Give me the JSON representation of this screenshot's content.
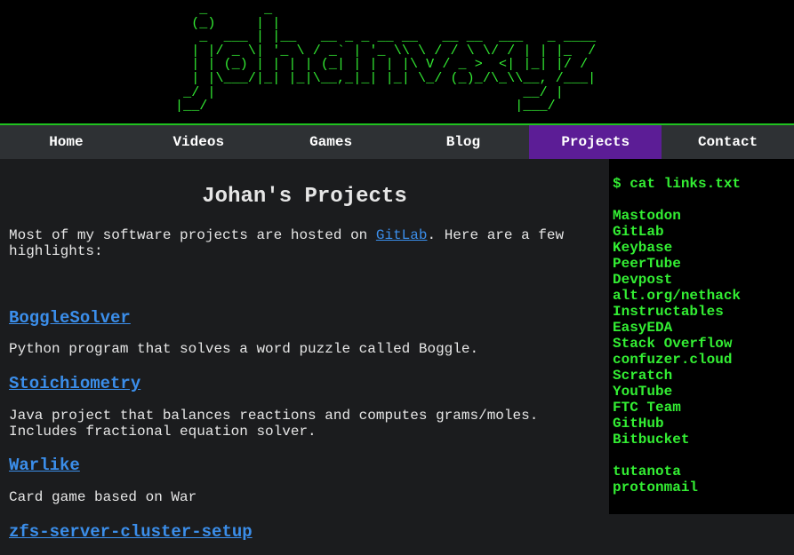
{
  "banner": {
    "ascii_logo": "   _       _                                        \n  (_)     | |                                       \n   _  ___ | |__   __ _ _ __ __   __ __  ___   _ ____\n  | |/ _ \\| '_ \\ / _` | '_ \\\\ \\ / / \\ \\/ / | | |_  /\n  | | (_) | | | | (_| | | | |\\ V / _ >  <| |_| |/ / \n  | |\\___/|_| |_|\\__,_|_| |_| \\_/ (_)_/\\_\\\\__, /___|\n _/ |                                      __/ |    \n|__/                                      |___/     ",
    "ascii_text": "johanv.xyz"
  },
  "nav": {
    "items": [
      {
        "label": "Home",
        "active": false
      },
      {
        "label": "Videos",
        "active": false
      },
      {
        "label": "Games",
        "active": false
      },
      {
        "label": "Blog",
        "active": false
      },
      {
        "label": "Projects",
        "active": true
      },
      {
        "label": "Contact",
        "active": false
      }
    ]
  },
  "main": {
    "title": "Johan's Projects",
    "intro_before": "Most of my software projects are hosted on ",
    "intro_link": "GitLab",
    "intro_after": ". Here are a few\nhighlights:",
    "projects": [
      {
        "name": "BoggleSolver",
        "description": "Python program that solves a word puzzle called Boggle."
      },
      {
        "name": "Stoichiometry",
        "description": "Java project that balances reactions and computes grams/moles.\nIncludes fractional equation solver."
      },
      {
        "name": "Warlike",
        "description": "Card game based on War"
      },
      {
        "name": "zfs-server-cluster-setup",
        "description": ""
      }
    ]
  },
  "sidebar": {
    "prompt": "$ cat links.txt",
    "links": [
      "Mastodon",
      "GitLab",
      "Keybase",
      "PeerTube",
      "Devpost",
      "alt.org/nethack",
      "Instructables",
      "EasyEDA",
      "Stack Overflow",
      "confuzer.cloud",
      "Scratch",
      "YouTube",
      "FTC Team",
      "GitHub",
      "Bitbucket"
    ],
    "email_links": [
      "tutanota",
      "protonmail"
    ]
  },
  "colors": {
    "terminal_green": "#33ee33",
    "active_nav": "#5c1d96",
    "link_blue": "#3b8eea",
    "nav_bg": "#2e3134",
    "page_bg": "#1b1c1e"
  }
}
